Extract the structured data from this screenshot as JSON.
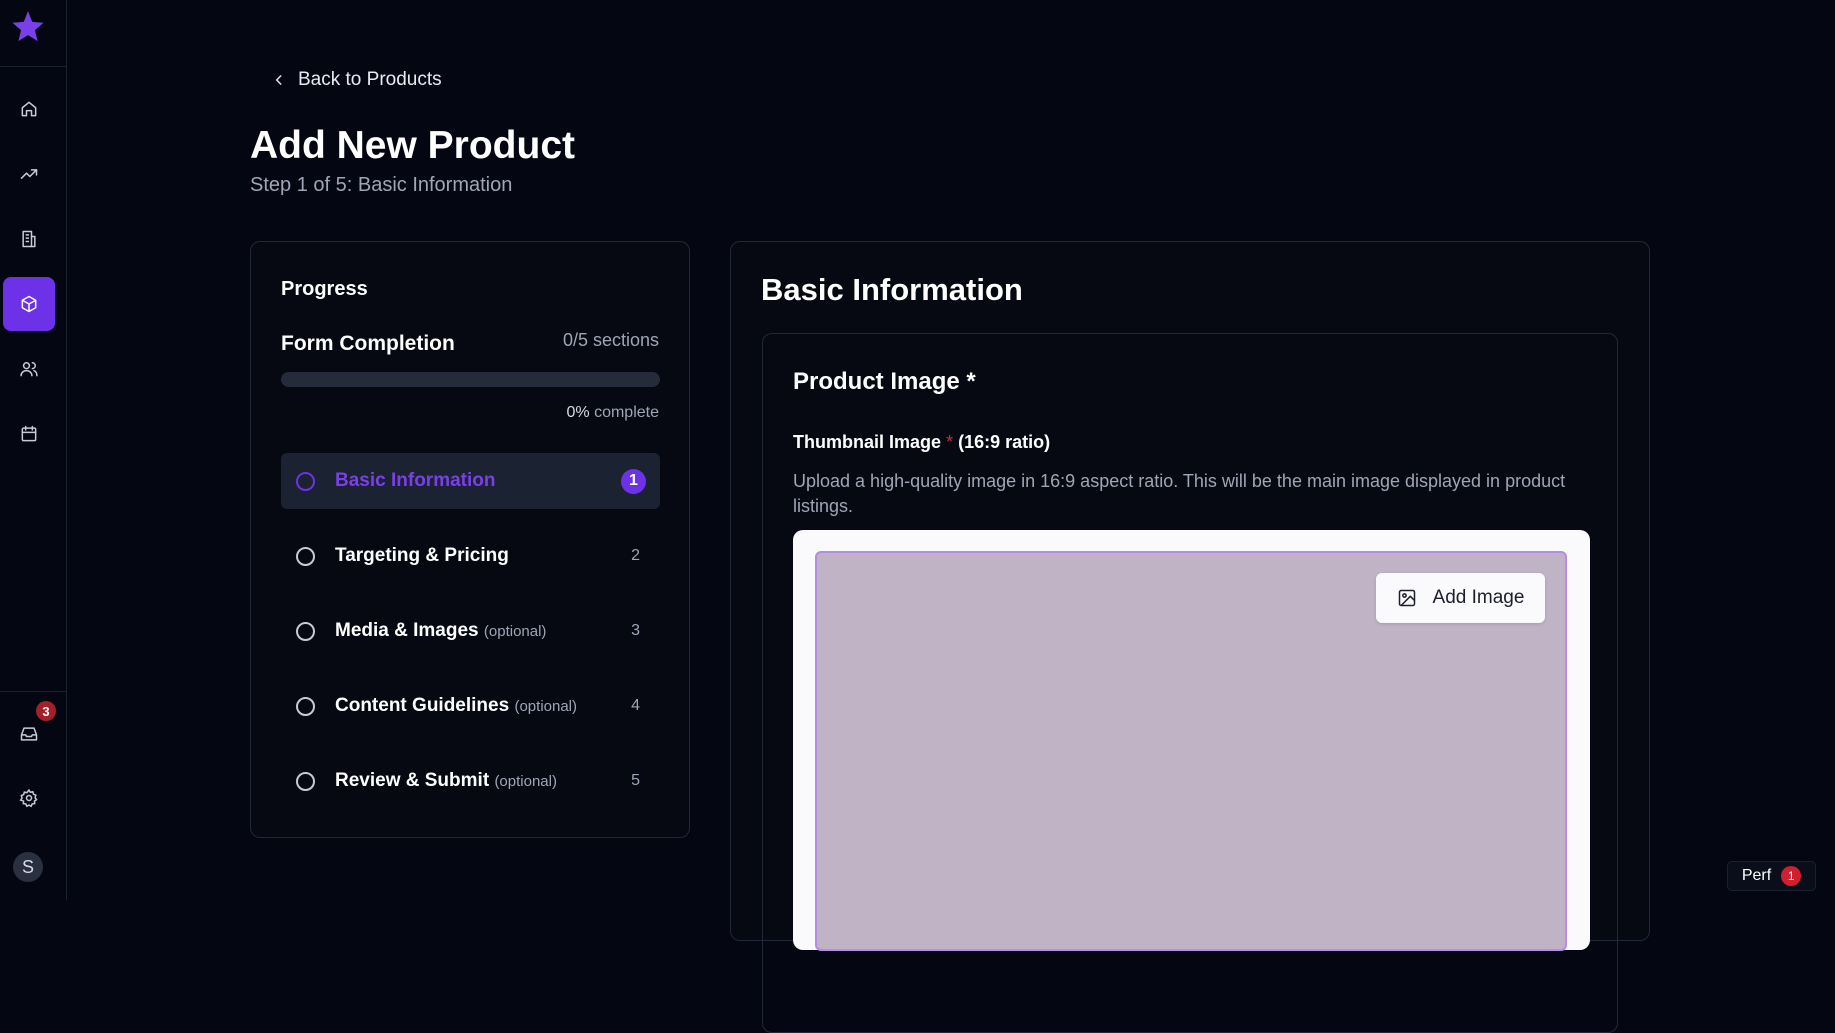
{
  "sidebar": {
    "logo_icon": "star-logo-icon",
    "items": [
      {
        "name": "home",
        "icon": "home-icon",
        "active": false
      },
      {
        "name": "analytics",
        "icon": "trending-up-icon",
        "active": false
      },
      {
        "name": "buildings",
        "icon": "building-icon",
        "active": false
      },
      {
        "name": "products",
        "icon": "box-icon",
        "active": true
      },
      {
        "name": "users",
        "icon": "users-icon",
        "active": false
      },
      {
        "name": "calendar",
        "icon": "calendar-icon",
        "active": false
      }
    ],
    "inbox_badge": "3",
    "avatar_initial": "S"
  },
  "header": {
    "back_label": "Back to Products",
    "title": "Add New Product",
    "subtitle": "Step 1 of 5: Basic Information"
  },
  "progress": {
    "title": "Progress",
    "completion_label": "Form Completion",
    "sections_count": "0/5 sections",
    "percent_value": "0%",
    "percent_suffix": "complete",
    "fraction": 0,
    "steps": [
      {
        "label": "Basic Information",
        "optional": "",
        "num": "1",
        "active": true
      },
      {
        "label": "Targeting & Pricing",
        "optional": "",
        "num": "2",
        "active": false
      },
      {
        "label": "Media & Images",
        "optional": "(optional)",
        "num": "3",
        "active": false
      },
      {
        "label": "Content Guidelines",
        "optional": "(optional)",
        "num": "4",
        "active": false
      },
      {
        "label": "Review & Submit",
        "optional": "(optional)",
        "num": "5",
        "active": false
      }
    ]
  },
  "main": {
    "title": "Basic Information",
    "product_image_title": "Product Image *",
    "thumbnail_label": "Thumbnail Image",
    "required_mark": "*",
    "ratio_label": "(16:9 ratio)",
    "thumbnail_help": "Upload a high-quality image in 16:9 aspect ratio. This will be the main image displayed in product listings.",
    "add_image_label": "Add Image"
  },
  "perf": {
    "label": "Perf",
    "count": "1"
  },
  "colors": {
    "accent": "#6d31e8",
    "background": "#040712",
    "danger": "#a3202a"
  }
}
